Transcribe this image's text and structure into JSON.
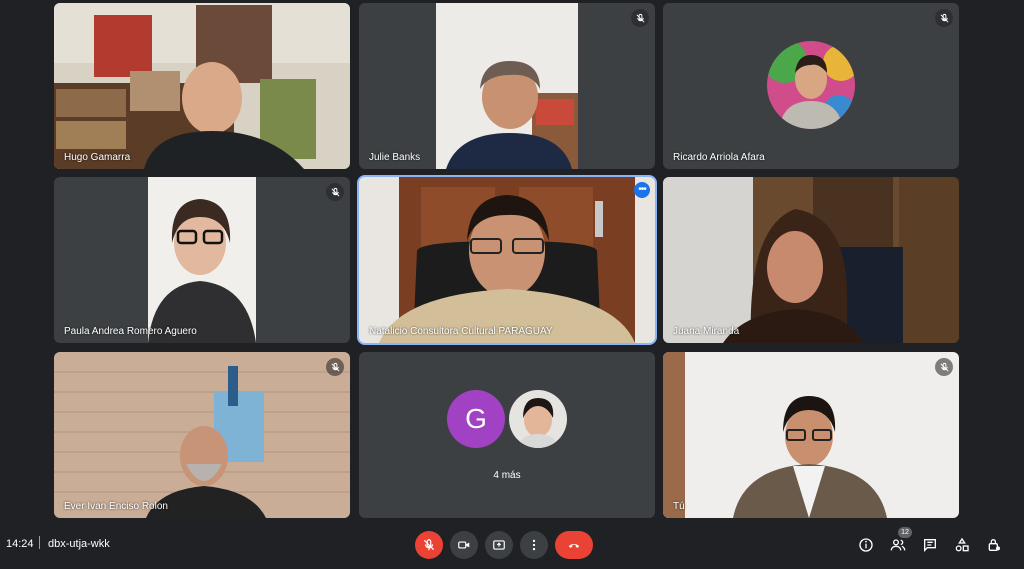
{
  "participants": [
    {
      "name": "Hugo Gamarra",
      "muted": false
    },
    {
      "name": "Julie Banks",
      "muted": true
    },
    {
      "name": "Ricardo Arriola Afara",
      "muted": true
    },
    {
      "name": "Paula Andrea Romero Aguero",
      "muted": true
    },
    {
      "name": "Natalicio Consultora Cultural PARAGUAY",
      "muted": false,
      "active": true
    },
    {
      "name": "Juana Miranda",
      "muted": false
    },
    {
      "name": "Ever Ivan Enciso Rolon",
      "muted": true
    },
    {
      "name": "Tú",
      "muted": true
    }
  ],
  "others_tile": {
    "avatar_letter": "G",
    "avatar_color": "#a142c4",
    "label": "4 más"
  },
  "bottom_bar": {
    "time": "14:24",
    "meeting_code": "dbx-utja-wkk",
    "people_count": "12",
    "controls": [
      "mic-off-icon",
      "camera-icon",
      "present-icon",
      "more-options-icon",
      "hang-up-icon"
    ],
    "right_icons": [
      "info-icon",
      "people-icon",
      "chat-icon",
      "activities-icon",
      "host-controls-icon"
    ]
  },
  "colors": {
    "background": "#202124",
    "tile": "#3c4043",
    "danger": "#ea4335",
    "accent": "#8ab4f8"
  }
}
